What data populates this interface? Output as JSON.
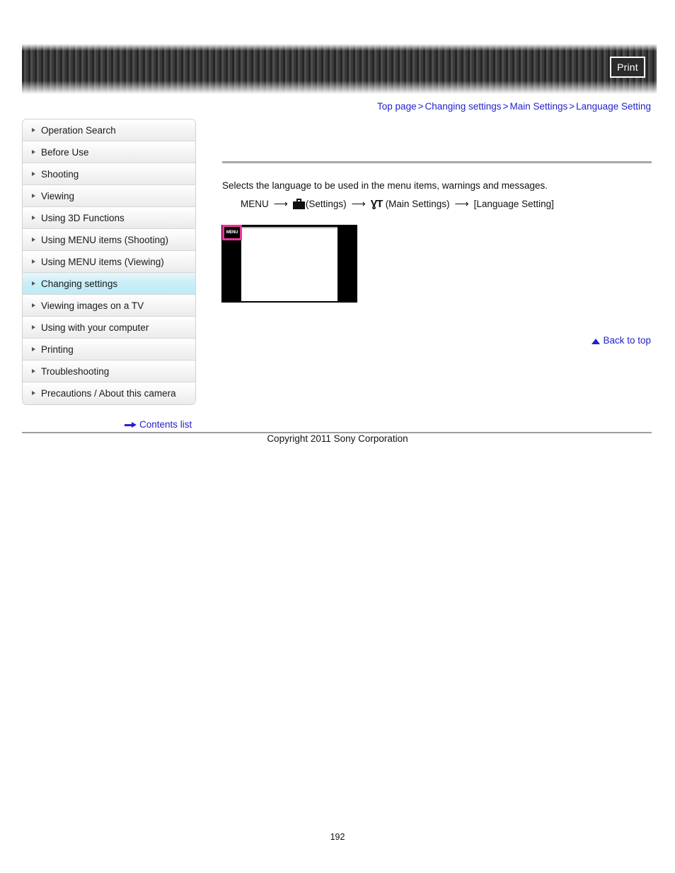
{
  "header": {
    "print_label": "Print"
  },
  "breadcrumb": {
    "items": [
      {
        "label": "Top page"
      },
      {
        "label": "Changing settings"
      },
      {
        "label": "Main Settings"
      },
      {
        "label": "Language Setting"
      }
    ],
    "separator": ">"
  },
  "sidebar": {
    "items": [
      {
        "label": "Operation Search",
        "active": false
      },
      {
        "label": "Before Use",
        "active": false
      },
      {
        "label": "Shooting",
        "active": false
      },
      {
        "label": "Viewing",
        "active": false
      },
      {
        "label": "Using 3D Functions",
        "active": false
      },
      {
        "label": "Using MENU items (Shooting)",
        "active": false
      },
      {
        "label": "Using MENU items (Viewing)",
        "active": false
      },
      {
        "label": "Changing settings",
        "active": true
      },
      {
        "label": "Viewing images on a TV",
        "active": false
      },
      {
        "label": "Using with your computer",
        "active": false
      },
      {
        "label": "Printing",
        "active": false
      },
      {
        "label": "Troubleshooting",
        "active": false
      },
      {
        "label": "Precautions / About this camera",
        "active": false
      }
    ],
    "contents_list_label": "Contents list"
  },
  "main": {
    "intro_text": "Selects the language to be used in the menu items, warnings and messages.",
    "menu_path": {
      "start": "MENU",
      "arrow": "⟶",
      "settings_label": "(Settings)",
      "main_settings_label": "(Main Settings)",
      "target_label": "[Language Setting]",
      "tools_glyph": "ƔT"
    },
    "camera_shot": {
      "menu_key_label": "MENU",
      "highlight_color": "#f0339c"
    },
    "back_to_top_label": "Back to top"
  },
  "footer": {
    "copyright": "Copyright 2011 Sony Corporation",
    "page_number": "192"
  }
}
